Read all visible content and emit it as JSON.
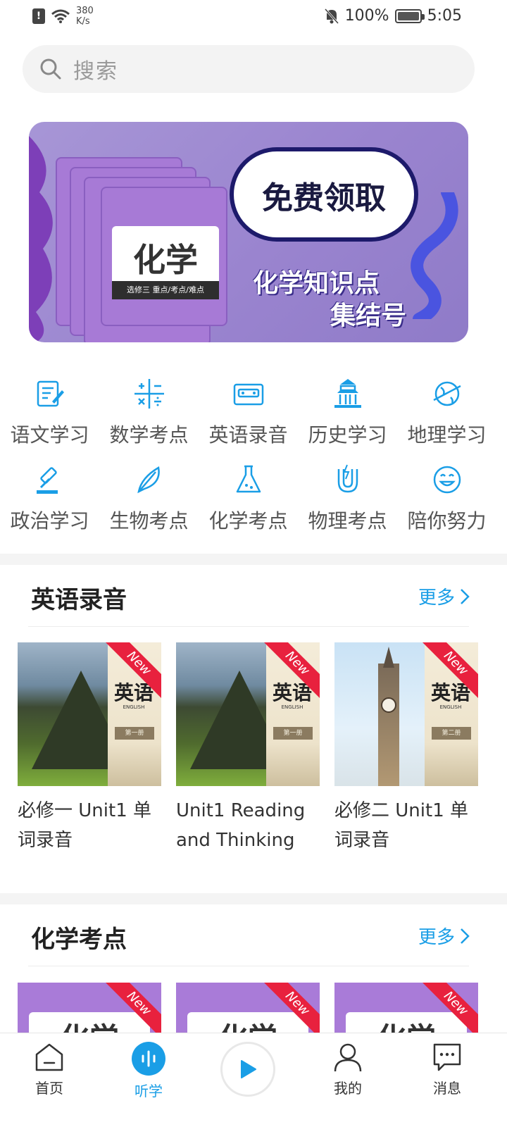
{
  "status_bar": {
    "speed_value": "380",
    "speed_unit": "K/s",
    "battery": "100%",
    "battery_level": 1.0,
    "time": "5:05"
  },
  "search": {
    "placeholder": "搜索"
  },
  "banner": {
    "book_title": "化学",
    "book_subtitle": "选修三 重点/考点/难点",
    "cloud_text": "免费领取",
    "line1": "化学知识点",
    "line2": "集结号"
  },
  "categories": [
    {
      "label": "语文学习",
      "icon": "notebook-pen-icon"
    },
    {
      "label": "数学考点",
      "icon": "math-symbols-icon"
    },
    {
      "label": "英语录音",
      "icon": "cassette-tape-icon"
    },
    {
      "label": "历史学习",
      "icon": "temple-icon"
    },
    {
      "label": "地理学习",
      "icon": "planet-icon"
    },
    {
      "label": "政治学习",
      "icon": "gavel-icon"
    },
    {
      "label": "生物考点",
      "icon": "leaf-icon"
    },
    {
      "label": "化学考点",
      "icon": "flask-icon"
    },
    {
      "label": "物理考点",
      "icon": "magnet-icon"
    },
    {
      "label": "陪你努力",
      "icon": "smile-icon"
    }
  ],
  "sections": [
    {
      "title": "英语录音",
      "more": "更多",
      "cards": [
        {
          "title": "必修一 Unit1 单词录音",
          "cover_title": "英语",
          "cover_sub": "ENGLISH",
          "cover_vol": "第一册",
          "badge": "New"
        },
        {
          "title": "Unit1 Reading and Thinking",
          "cover_title": "英语",
          "cover_sub": "ENGLISH",
          "cover_vol": "第一册",
          "badge": "New"
        },
        {
          "title": "必修二 Unit1 单词录音",
          "cover_title": "英语",
          "cover_sub": "ENGLISH",
          "cover_vol": "第二册",
          "badge": "New"
        }
      ]
    },
    {
      "title": "化学考点",
      "more": "更多",
      "cards": [
        {
          "cover_title": "化学",
          "badge": "New"
        },
        {
          "cover_title": "化学",
          "badge": "New"
        },
        {
          "cover_title": "化学",
          "badge": "New"
        }
      ]
    }
  ],
  "bottom_nav": [
    {
      "label": "首页",
      "icon": "home-icon",
      "active": false
    },
    {
      "label": "听学",
      "icon": "audio-wave-icon",
      "active": true
    },
    {
      "label": "",
      "icon": "play-icon",
      "active": false
    },
    {
      "label": "我的",
      "icon": "user-icon",
      "active": false
    },
    {
      "label": "消息",
      "icon": "chat-icon",
      "active": false
    }
  ],
  "colors": {
    "accent": "#1a9ee6",
    "badge": "#e8213e",
    "banner": "#9a84cf"
  }
}
